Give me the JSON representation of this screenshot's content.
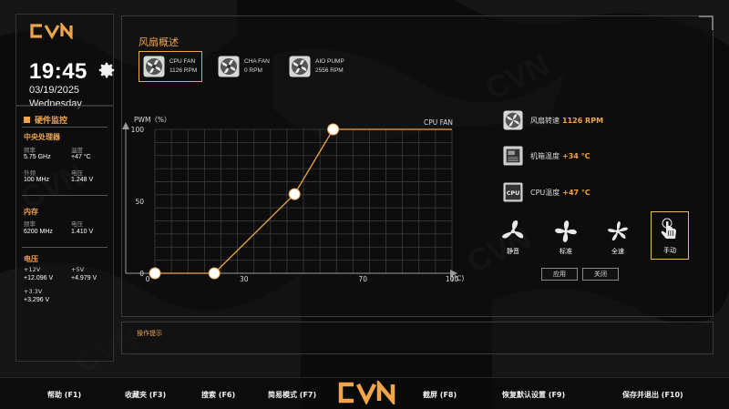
{
  "clock": {
    "time": "19:45",
    "date": "03/19/2025",
    "weekday": "Wednesday"
  },
  "brand": {
    "logo": "cvn-logo"
  },
  "hardware": {
    "title": "硬件监控",
    "cpu": {
      "title": "中央处理器",
      "freq_label": "频率",
      "freq_value": "5.75 GHz",
      "temp_label": "温度",
      "temp_value": "+47 °C",
      "ext_label": "外频",
      "ext_value": "100 MHz",
      "volt_label": "电压",
      "volt_value": "1.248 V"
    },
    "memory": {
      "title": "内存",
      "freq_label": "频率",
      "freq_value": "6200 MHz",
      "volt_label": "电压",
      "volt_value": "1.410 V"
    },
    "voltage": {
      "title": "电压",
      "v12_label": "+12V",
      "v12_value": "+12.096 V",
      "v5_label": "+5V",
      "v5_value": "+4.979 V",
      "v33_label": "+3.3V",
      "v33_value": "+3.296 V"
    }
  },
  "fan_overview": {
    "title": "风扇概述",
    "fans": [
      {
        "name": "CPU FAN",
        "rpm": "1126 RPM",
        "active": true
      },
      {
        "name": "CHA FAN",
        "rpm": "0 RPM",
        "active": false
      },
      {
        "name": "AIO PUMP",
        "rpm": "2556 RPM",
        "active": false
      }
    ]
  },
  "chart_data": {
    "type": "line",
    "ylabel": "PWM（%）",
    "xlabel": "(℃)",
    "series": [
      {
        "name": "CPU FAN",
        "x": [
          0,
          20,
          47,
          60,
          100
        ],
        "y": [
          0,
          0,
          55,
          100,
          100
        ]
      }
    ],
    "curve_points_x": [
      0,
      20,
      47,
      60
    ],
    "curve_points_y": [
      0,
      0,
      55,
      100
    ],
    "xlim": [
      0,
      100
    ],
    "ylim": [
      0,
      100
    ],
    "xticks": [
      "0",
      "30",
      "70",
      "100"
    ],
    "xtick_values": [
      0,
      30,
      70,
      100
    ],
    "yticks": [
      "0",
      "50",
      "100"
    ],
    "ytick_values": [
      0,
      50,
      100
    ],
    "grid": true,
    "color": "#f0a54a"
  },
  "status": {
    "fan_speed_label": "风扇转速",
    "fan_speed_value": "1126 RPM",
    "case_temp_label": "机箱温度",
    "case_temp_value": "+34 °C",
    "cpu_temp_label": "CPU温度",
    "cpu_temp_value": "+47 °C",
    "cpu_icon_text": "CPU"
  },
  "modes": [
    {
      "label": "静音",
      "icon": "fan-icon",
      "active": false
    },
    {
      "label": "标准",
      "icon": "fan-icon",
      "active": false
    },
    {
      "label": "全速",
      "icon": "fan-icon",
      "active": false
    },
    {
      "label": "手动",
      "icon": "hand-pointer-icon",
      "active": true
    }
  ],
  "buttons": {
    "apply": "应用",
    "close": "关闭"
  },
  "tips": {
    "title": "操作提示"
  },
  "footer": {
    "help": "帮助 (F1)",
    "favorites": "收藏夹 (F3)",
    "search": "搜索 (F6)",
    "easy_mode": "简易模式 (F7)",
    "screenshot": "截屏 (F8)",
    "restore": "恢复默认设置 (F9)",
    "save_exit": "保存并退出 (F10)"
  },
  "colors": {
    "accent": "#f0a54a",
    "text": "#e6e6e6",
    "background": "#0b0b0b"
  }
}
